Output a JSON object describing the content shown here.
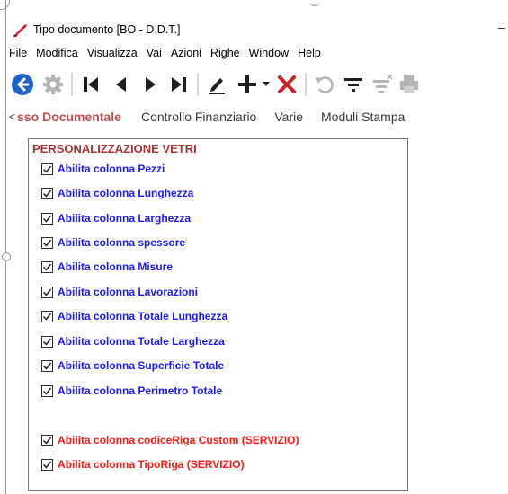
{
  "window": {
    "title": "Tipo documento [BO - D.D.T.]"
  },
  "menu": [
    "File",
    "Modifica",
    "Visualizza",
    "Vai",
    "Azioni",
    "Righe",
    "Window",
    "Help"
  ],
  "toolbar": {
    "icons": [
      "back-icon",
      "gear-icon",
      "first-record-icon",
      "previous-record-icon",
      "next-record-icon",
      "last-record-icon",
      "edit-icon",
      "add-icon",
      "dropdown-arrow-icon",
      "delete-icon",
      "undo-icon",
      "filter-icon",
      "clear-filter-icon",
      "print-icon"
    ],
    "colors": {
      "primary": "#1e64c8",
      "delete": "#cc2222",
      "disabled": "#b5b5b5",
      "dark": "#1f1f1f"
    }
  },
  "tabs": {
    "scroll_left": "<",
    "items": [
      {
        "label": "sso Documentale",
        "active": true
      },
      {
        "label": "Controllo Finanziario",
        "active": false
      },
      {
        "label": "Varie",
        "active": false
      },
      {
        "label": "Moduli Stampa",
        "active": false
      }
    ]
  },
  "section": {
    "title": "PERSONALIZZAZIONE VETRI",
    "options_blue": [
      {
        "label": "Abilita colonna Pezzi",
        "checked": true
      },
      {
        "label": "Abilita colonna Lunghezza",
        "checked": true
      },
      {
        "label": "Abilita colonna Larghezza",
        "checked": true
      },
      {
        "label": "Abilita colonna spessore",
        "checked": true
      },
      {
        "label": "Abilita colonna Misure",
        "checked": true
      },
      {
        "label": "Abilita colonna Lavorazioni",
        "checked": true
      },
      {
        "label": "Abilita colonna Totale Lunghezza",
        "checked": true
      },
      {
        "label": "Abilita colonna Totale Larghezza",
        "checked": true
      },
      {
        "label": "Abilita colonna Superficie Totale",
        "checked": true
      },
      {
        "label": "Abilita colonna Perimetro Totale",
        "checked": true
      }
    ],
    "options_red": [
      {
        "label": "Abilita colonna codiceRiga Custom (SERVIZIO)",
        "checked": true
      },
      {
        "label": "Abilita colonna TipoRiga (SERVIZIO)",
        "checked": true
      }
    ]
  }
}
